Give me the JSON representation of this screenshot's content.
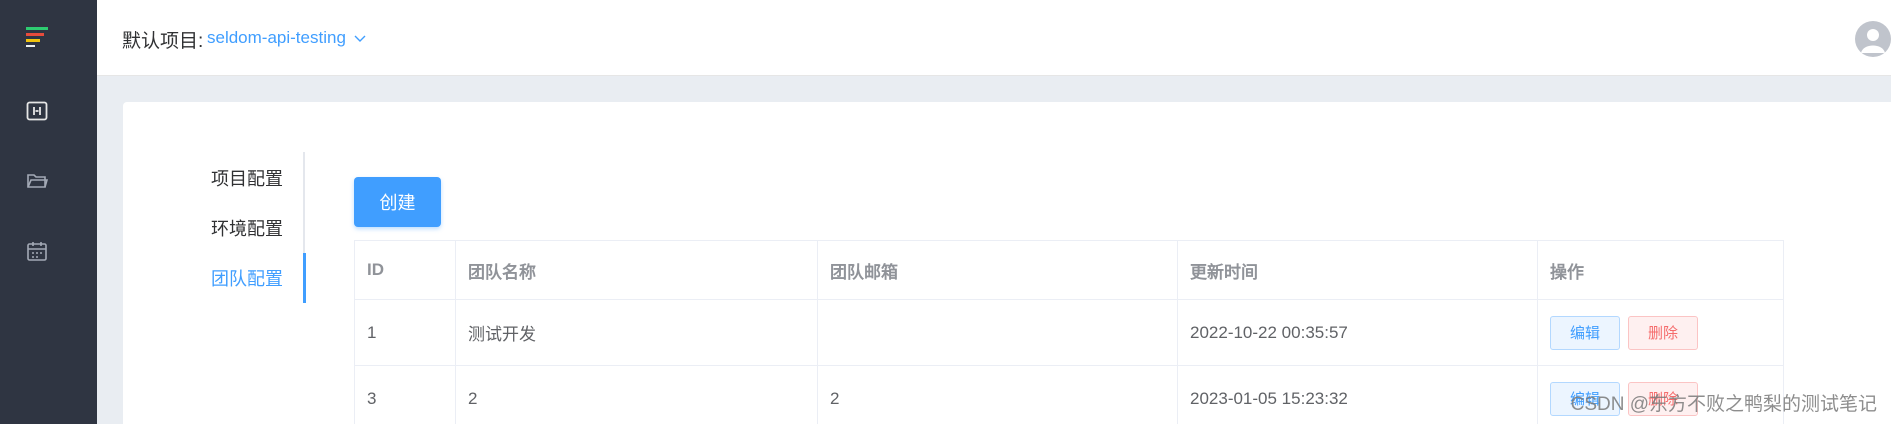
{
  "sidebar": {
    "items": [
      {
        "icon": "logo-icon"
      },
      {
        "icon": "api-icon"
      },
      {
        "icon": "folder-icon"
      },
      {
        "icon": "calendar-icon"
      }
    ]
  },
  "header": {
    "project_label": "默认项目:",
    "project_value": "seldom-api-testing"
  },
  "tabs": [
    {
      "label": "项目配置",
      "active": false
    },
    {
      "label": "环境配置",
      "active": false
    },
    {
      "label": "团队配置",
      "active": true
    }
  ],
  "create_button": "创建",
  "table": {
    "headers": [
      "ID",
      "团队名称",
      "团队邮箱",
      "更新时间",
      "操作"
    ],
    "rows": [
      {
        "id": "1",
        "name": "测试开发",
        "email": "",
        "updated": "2022-10-22 00:35:57",
        "edit": "编辑",
        "delete": "删除"
      },
      {
        "id": "3",
        "name": "2",
        "email": "2",
        "updated": "2023-01-05 15:23:32",
        "edit": "编辑",
        "delete": "删除"
      }
    ]
  },
  "watermark": "CSDN @东方不败之鸭梨的测试笔记",
  "colors": {
    "sidebar_bg": "#2f3542",
    "accent": "#409eff",
    "danger": "#f56c6c",
    "page_bg": "#e9edf2"
  }
}
